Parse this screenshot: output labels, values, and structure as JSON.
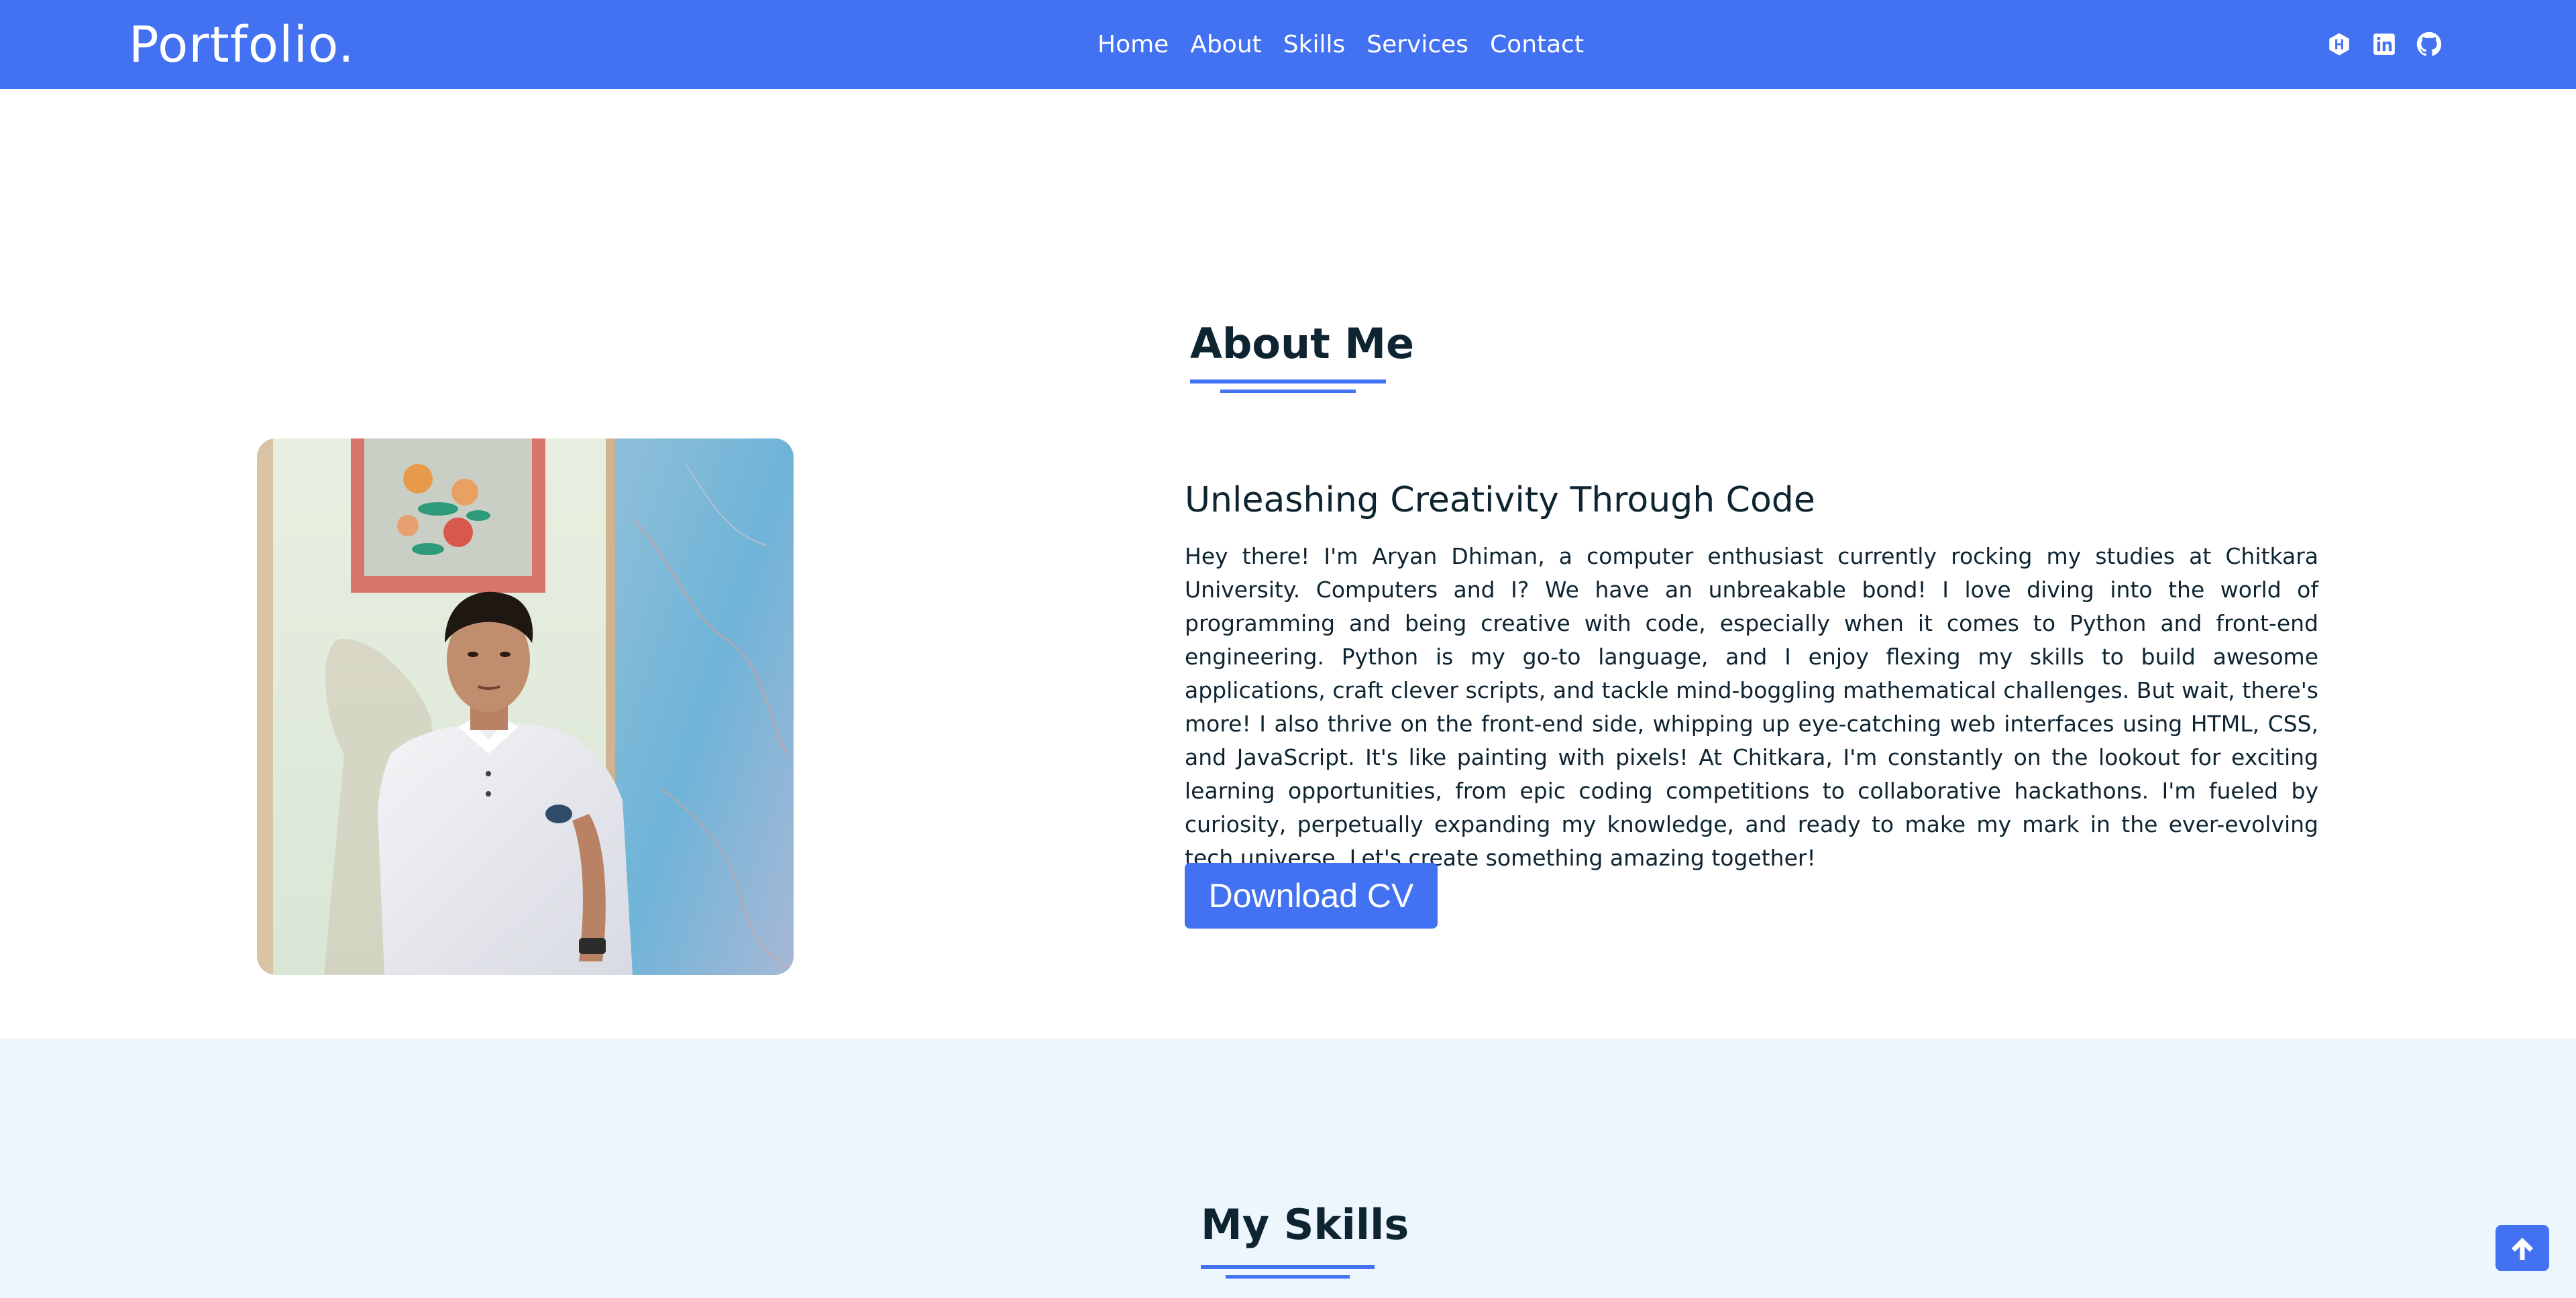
{
  "brand": {
    "name": "Portfolio."
  },
  "nav": {
    "links": [
      {
        "label": "Home"
      },
      {
        "label": "About"
      },
      {
        "label": "Skills"
      },
      {
        "label": "Services"
      },
      {
        "label": "Contact"
      }
    ],
    "icons": [
      "hackerrank-icon",
      "linkedin-icon",
      "github-icon"
    ]
  },
  "about": {
    "heading": "About Me",
    "subtitle": "Unleashing Creativity Through Code",
    "paragraph": "Hey there! I'm Aryan Dhiman, a computer enthusiast currently rocking my studies at Chitkara University. Computers and I? We have an unbreakable bond! I love diving into the world of programming and being creative with code, especially when it comes to Python and front-end engineering. Python is my go-to language, and I enjoy flexing my skills to build awesome applications, craft clever scripts, and tackle mind-boggling mathematical challenges. But wait, there's more! I also thrive on the front-end side, whipping up eye-catching web interfaces using HTML, CSS, and JavaScript. It's like painting with pixels! At Chitkara, I'm constantly on the lookout for exciting learning opportunities, from epic coding competitions to collaborative hackathons. I'm fueled by curiosity, perpetually expanding my knowledge, and ready to make my mark in the ever-evolving tech universe. Let's create something amazing together!",
    "button_label": "Download CV"
  },
  "skills": {
    "heading": "My Skills"
  },
  "colors": {
    "accent": "#4271f1",
    "text": "#0e2431",
    "skills_bg": "#eef6fd"
  }
}
